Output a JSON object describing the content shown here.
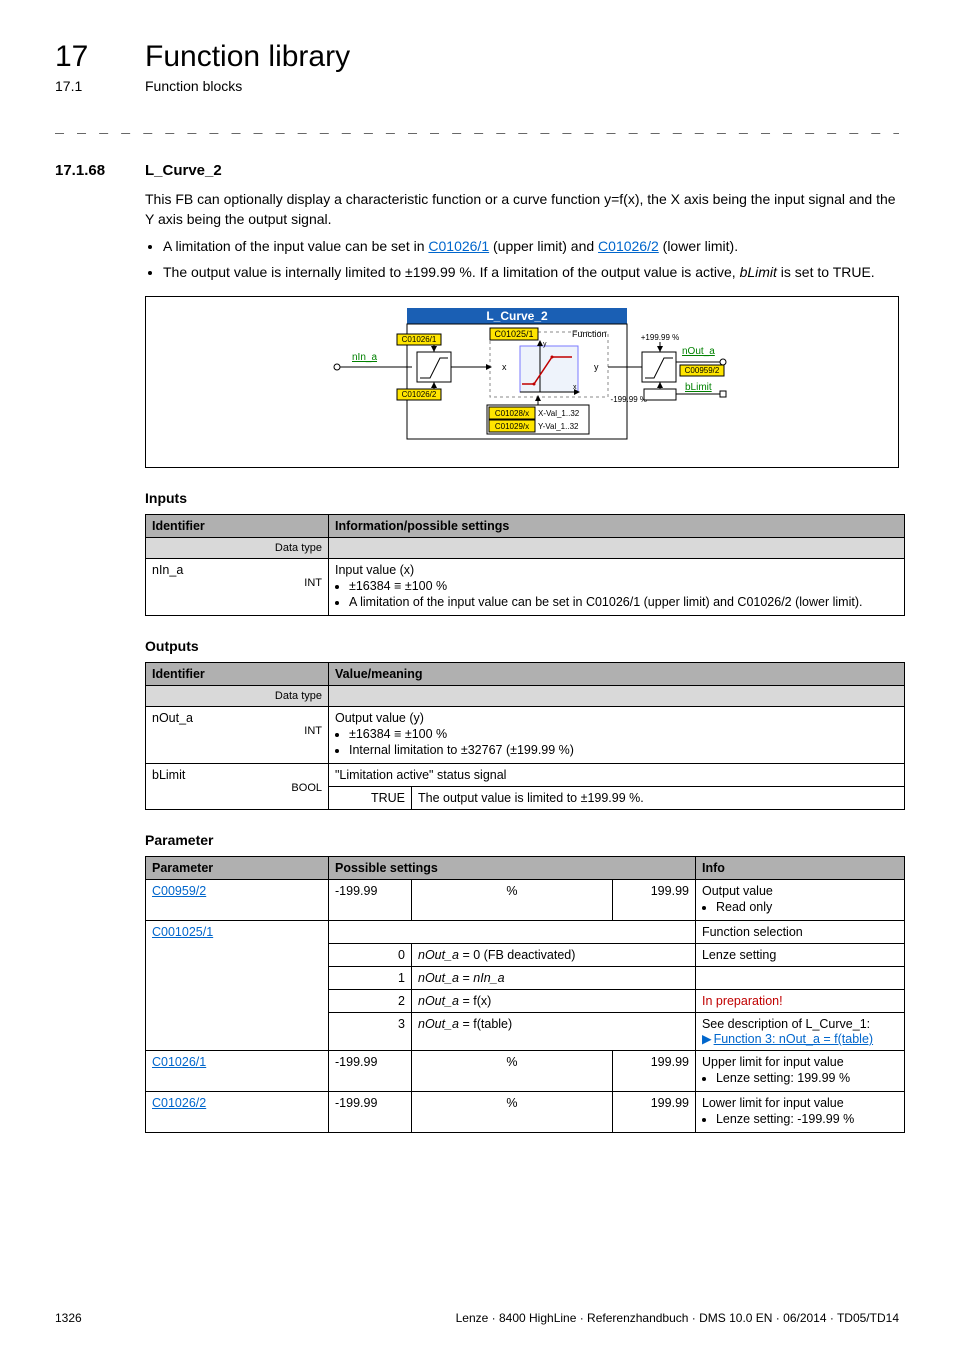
{
  "chapter": {
    "num": "17",
    "title": "Function library"
  },
  "subsection": {
    "num": "17.1",
    "title": "Function blocks"
  },
  "dashes": "_ _ _ _ _ _ _ _ _ _ _ _ _ _ _ _ _ _ _ _ _ _ _ _ _ _ _ _ _ _ _ _ _ _ _ _ _ _ _ _ _ _ _ _ _ _ _ _ _ _ _ _ _ _ _ _ _ _ _ _ _ _ _",
  "section": {
    "num": "17.1.68",
    "title": "L_Curve_2"
  },
  "intro_p1": "This FB can optionally display a characteristic function or a curve function y=f(x), the X axis being the input signal and the Y axis being the output signal.",
  "bullets": {
    "b1_pre": "A limitation of the input value can be set in ",
    "b1_l1": "C01026/1",
    "b1_mid": " (upper limit) and ",
    "b1_l2": "C01026/2",
    "b1_post": " (lower limit).",
    "b2_pre": "The output value is internally limited to ±199.99 %. If a limitation of the output value is active, ",
    "b2_it": "bLimit",
    "b2_post": " is set to TRUE."
  },
  "diagram": {
    "title": "L_Curve_2",
    "c01025": "C01025/1",
    "func": "Function",
    "c01026_1": "C01026/1",
    "c01026_2": "C01026/2",
    "nIn": "nIn_a",
    "x": "x",
    "y": "y",
    "c01028": "C01028/x",
    "c01029": "C01029/x",
    "xval": "X-Val_1..32",
    "yval": "Y-Val_1..32",
    "p199": "+199.99 %",
    "m199": "-199.99 %",
    "nOut": "nOut_a",
    "c00959": "C00959/2",
    "bLimit": "bLimit"
  },
  "headings": {
    "inputs": "Inputs",
    "outputs": "Outputs",
    "param": "Parameter"
  },
  "tbl": {
    "identifier": "Identifier",
    "datatype": "Data type",
    "info_settings": "Information/possible settings",
    "value_meaning": "Value/meaning",
    "possible": "Possible settings",
    "info": "Info",
    "parameter": "Parameter"
  },
  "inputs": {
    "id": "nIn_a",
    "dt": "INT",
    "desc_l1": "Input value (x)",
    "desc_b1": "±16384 ≡ ±100 %",
    "desc_b2": "A limitation of the input value can be set in C01026/1 (upper limit) and C01026/2 (lower limit)."
  },
  "outputs": {
    "r1_id": "nOut_a",
    "r1_dt": "INT",
    "r1_l1": "Output value (y)",
    "r1_b1": "±16384 ≡ ±100 %",
    "r1_b2": "Internal limitation to ±32767 (±199.99 %)",
    "r2_id": "bLimit",
    "r2_dt": "BOOL",
    "r2_l1": "\"Limitation active\" status signal",
    "r2_true": "TRUE",
    "r2_true_txt": "The output value is limited to ±199.99 %."
  },
  "params": {
    "c00959": "C00959/2",
    "c00959_min": "-199.99",
    "c00959_unit": "%",
    "c00959_max": "199.99",
    "c00959_info_l1": "Output value",
    "c00959_info_b1": "Read only",
    "c001025": "C001025/1",
    "c001025_info": "Function selection",
    "opt0_n": "0",
    "opt0_t": "nOut_a",
    "opt0_rest": " = 0 (FB deactivated)",
    "opt0_info": "Lenze setting",
    "opt1_n": "1",
    "opt1_t": "nOut_a",
    "opt1_rest": " = ",
    "opt1_t2": "nIn_a",
    "opt2_n": "2",
    "opt2_t": "nOut_a",
    "opt2_rest": " = f(x)",
    "opt2_info": "In preparation!",
    "opt3_n": "3",
    "opt3_t": "nOut_a",
    "opt3_rest": " = f(table)",
    "opt3_info_l1": "See description of L_Curve_1:",
    "opt3_info_link": "Function 3: nOut_a = f(table)",
    "c01026_1": "C01026/1",
    "c01026_1_min": "-199.99",
    "c01026_1_unit": "%",
    "c01026_1_max": "199.99",
    "c01026_1_info_l1": "Upper limit for input value",
    "c01026_1_info_b1": "Lenze setting: 199.99 %",
    "c01026_2": "C01026/2",
    "c01026_2_min": "-199.99",
    "c01026_2_unit": "%",
    "c01026_2_max": "199.99",
    "c01026_2_info_l1": "Lower limit for input value",
    "c01026_2_info_b1": "Lenze setting: -199.99 %"
  },
  "footer": {
    "page": "1326",
    "right": "Lenze · 8400 HighLine · Referenzhandbuch · DMS 10.0 EN · 06/2014 · TD05/TD14"
  }
}
